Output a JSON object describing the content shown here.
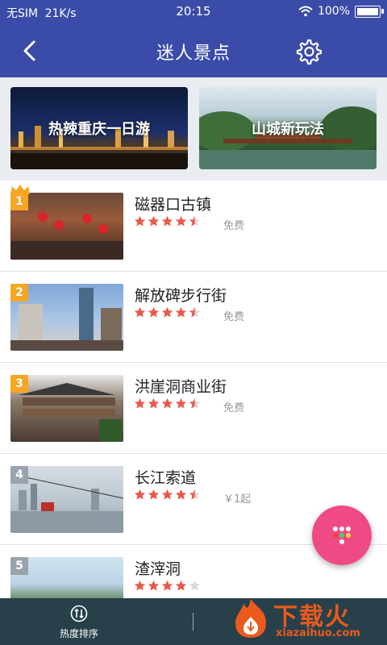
{
  "status": {
    "carrier": "无SIM",
    "speed": "21K/s",
    "time": "20:15",
    "battery": "100%"
  },
  "header": {
    "title": "迷人景点"
  },
  "banners": [
    {
      "label": "热辣重庆一日游"
    },
    {
      "label": "山城新玩法"
    }
  ],
  "items": [
    {
      "rank": "1",
      "name": "磁器口古镇",
      "rating": 4.5,
      "price": "免费",
      "rank_color": "#f5a623"
    },
    {
      "rank": "2",
      "name": "解放碑步行街",
      "rating": 4.5,
      "price": "免费",
      "rank_color": "#f5a623"
    },
    {
      "rank": "3",
      "name": "洪崖洞商业街",
      "rating": 4.5,
      "price": "免费",
      "rank_color": "#f5a623"
    },
    {
      "rank": "4",
      "name": "长江索道",
      "rating": 4.5,
      "price": "￥1起",
      "rank_color": "#9aa3ad"
    },
    {
      "rank": "5",
      "name": "渣滓洞",
      "rating": 4,
      "price": "",
      "rank_color": "#9aa3ad"
    }
  ],
  "bottom": {
    "sort_label": "热度排序"
  },
  "watermark": {
    "brand": "下载火",
    "domain": "xiazaihuo.com"
  },
  "colors": {
    "primary": "#3a4ba8",
    "star": "#e8584b",
    "fab": "#f04a86",
    "bottom": "#27404a"
  },
  "icons": {
    "back": "back-arrow-icon",
    "settings": "gear-icon",
    "fab": "dots-grid-icon",
    "sort": "sort-icon",
    "crown": "crown-icon"
  }
}
